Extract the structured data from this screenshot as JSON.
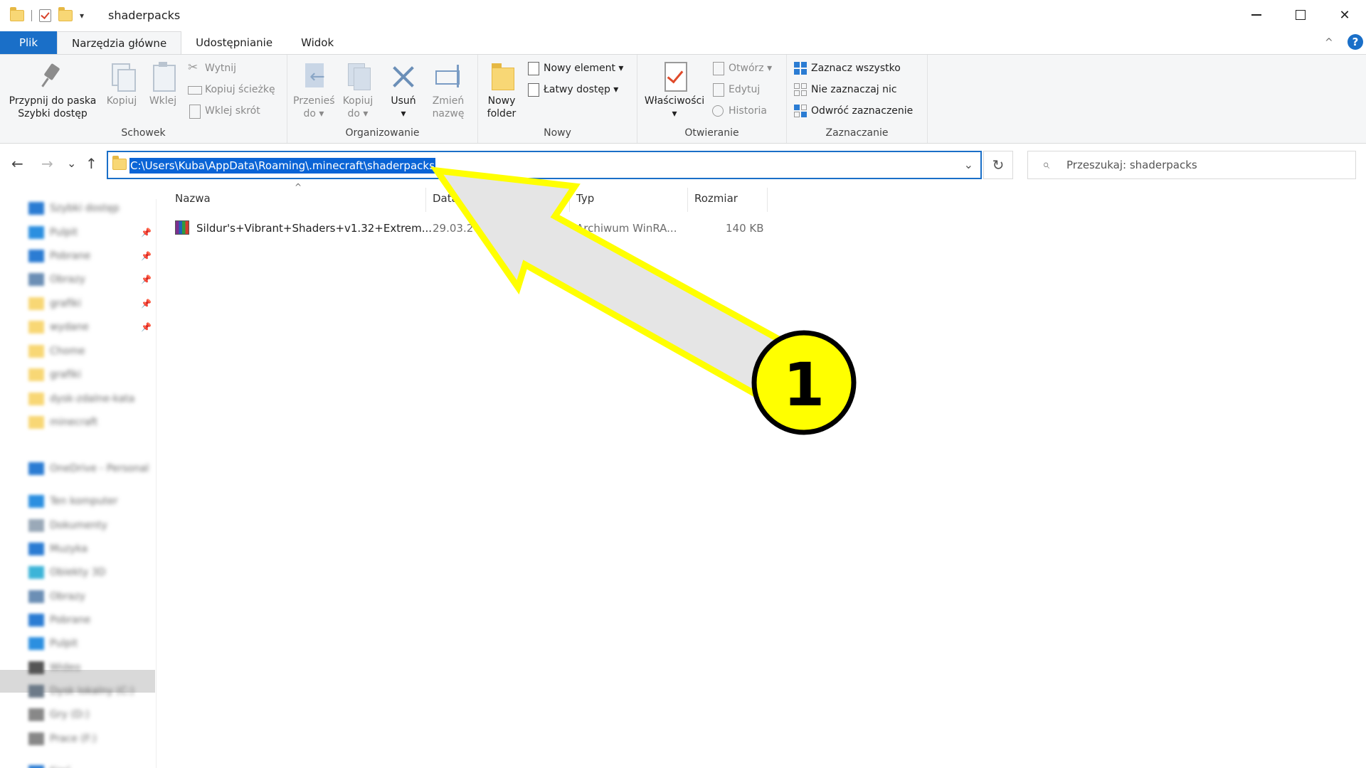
{
  "window": {
    "title": "shaderpacks",
    "qat_dropdown": "▾",
    "minimize": "",
    "maximize": "",
    "close": "✕"
  },
  "tabs": [
    {
      "label": "Plik"
    },
    {
      "label": "Narzędzia główne"
    },
    {
      "label": "Udostępnianie"
    },
    {
      "label": "Widok"
    }
  ],
  "help": "?",
  "ribbon": {
    "clipboard": {
      "label": "Schowek",
      "pin_line1": "Przypnij do paska",
      "pin_line2": "Szybki dostęp",
      "copy": "Kopiuj",
      "paste": "Wklej",
      "cut": "Wytnij",
      "copy_path": "Kopiuj ścieżkę",
      "paste_shortcut": "Wklej skrót"
    },
    "organize": {
      "label": "Organizowanie",
      "move_line1": "Przenieś",
      "move_line2": "do ▾",
      "copyto_line1": "Kopiuj",
      "copyto_line2": "do ▾",
      "delete_line1": "Usuń",
      "delete_line2": "▾",
      "rename_line1": "Zmień",
      "rename_line2": "nazwę"
    },
    "new": {
      "label": "Nowy",
      "new_item": "Nowy element ▾",
      "easy_access": "Łatwy dostęp ▾",
      "new_folder_line1": "Nowy",
      "new_folder_line2": "folder"
    },
    "open": {
      "label": "Otwieranie",
      "properties_line1": "Właściwości",
      "properties_line2": "▾",
      "open": "Otwórz ▾",
      "edit": "Edytuj",
      "history": "Historia"
    },
    "select": {
      "label": "Zaznaczanie",
      "select_all": "Zaznacz wszystko",
      "select_none": "Nie zaznaczaj nic",
      "invert": "Odwróć zaznaczenie"
    }
  },
  "nav": {
    "back": "←",
    "forward": "→",
    "recent": "⌄",
    "up": "↑",
    "address": "C:\\Users\\Kuba\\AppData\\Roaming\\.minecraft\\shaderpacks",
    "address_dropdown": "⌄",
    "refresh": "↻",
    "search_icon": "⌕",
    "search_placeholder": "Przeszukaj: shaderpacks"
  },
  "columns": {
    "name": "Nazwa",
    "date": "Data",
    "type": "Typ",
    "size": "Rozmiar",
    "sort_caret": "^"
  },
  "files": [
    {
      "name": "Sildur's+Vibrant+Shaders+v1.32+Extrem...",
      "date": "29.03.20",
      "type": "Archiwum WinRA...",
      "size": "140 KB"
    }
  ],
  "sidebar": {
    "items": [
      {
        "label": "Szybki dostęp",
        "icon": "star-icon",
        "color": "#2b7cd3"
      },
      {
        "label": "Pulpit",
        "icon": "desktop-icon",
        "color": "#2b8fe0",
        "pinned": true
      },
      {
        "label": "Pobrane",
        "icon": "download-icon",
        "color": "#2b7cd3",
        "pinned": true
      },
      {
        "label": "Obrazy",
        "icon": "pictures-icon",
        "color": "#6c8fb5",
        "pinned": true
      },
      {
        "label": "grafiki",
        "icon": "folder-icon",
        "color": "#f8d775",
        "pinned": true
      },
      {
        "label": "wydane",
        "icon": "folder-icon",
        "color": "#f8d775",
        "pinned": true
      },
      {
        "label": "Chome",
        "icon": "folder-icon",
        "color": "#f8d775"
      },
      {
        "label": "grafiki",
        "icon": "folder-icon",
        "color": "#f8d775"
      },
      {
        "label": "dysk-zdalne-kata",
        "icon": "folder-icon",
        "color": "#f8d775"
      },
      {
        "label": "minecraft",
        "icon": "folder-icon",
        "color": "#f8d775"
      },
      {
        "label": "OneDrive - Personal",
        "icon": "cloud-icon",
        "color": "#2b7cd3"
      },
      {
        "label": "Ten komputer",
        "icon": "computer-icon",
        "color": "#2b8fe0"
      },
      {
        "label": "Dokumenty",
        "icon": "documents-icon",
        "color": "#9aa9b8"
      },
      {
        "label": "Muzyka",
        "icon": "music-icon",
        "color": "#2b7cd3"
      },
      {
        "label": "Obiekty 3D",
        "icon": "objects3d-icon",
        "color": "#3cb4d8"
      },
      {
        "label": "Obrazy",
        "icon": "pictures-icon",
        "color": "#6c8fb5"
      },
      {
        "label": "Pobrane",
        "icon": "download-icon",
        "color": "#2b7cd3"
      },
      {
        "label": "Pulpit",
        "icon": "desktop-icon",
        "color": "#2b8fe0"
      },
      {
        "label": "Wideo",
        "icon": "video-icon",
        "color": "#555555"
      },
      {
        "label": "Dysk lokalny (C:)",
        "icon": "drive-icon",
        "color": "#6d7a88",
        "selected": true
      },
      {
        "label": "Gry (D:)",
        "icon": "drive-icon",
        "color": "#888888"
      },
      {
        "label": "Prace (F:)",
        "icon": "drive-icon",
        "color": "#888888"
      },
      {
        "label": "Sieć",
        "icon": "network-icon",
        "color": "#2b7cd3"
      }
    ],
    "pin_glyph": "📌"
  },
  "annotation": {
    "step": "1",
    "arrow_color": "#ffff00",
    "arrow_fill": "#e5e5e5",
    "badge_color": "#ffff00"
  }
}
